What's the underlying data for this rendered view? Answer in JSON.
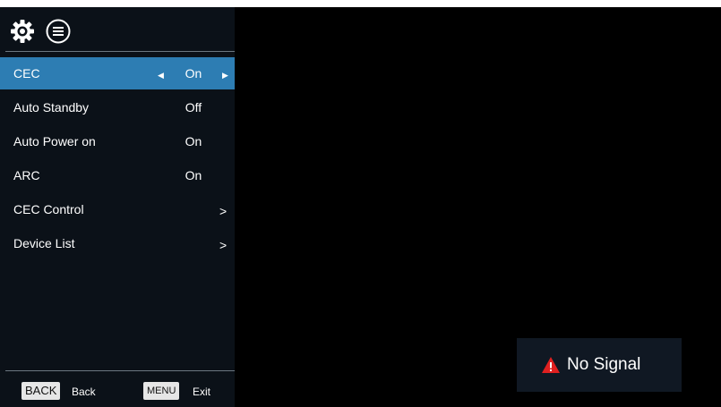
{
  "colors": {
    "screen_background": "#000000",
    "panel_background": "#0b1118",
    "selected_row": "#2d7db3",
    "warning_red": "#e02020"
  },
  "header": {
    "icons": [
      "settings-icon",
      "list-icon"
    ]
  },
  "menu": {
    "items": [
      {
        "label": "CEC",
        "value": "On",
        "selected": true,
        "control": "left-right-arrows"
      },
      {
        "label": "Auto Standby",
        "value": "Off",
        "selected": false,
        "control": "none"
      },
      {
        "label": "Auto Power on",
        "value": "On",
        "selected": false,
        "control": "none"
      },
      {
        "label": "ARC",
        "value": "On",
        "selected": false,
        "control": "none"
      },
      {
        "label": "CEC Control",
        "value": "",
        "selected": false,
        "control": "chevron",
        "chevron": ">"
      },
      {
        "label": "Device List",
        "value": "",
        "selected": false,
        "control": "chevron",
        "chevron": ">"
      }
    ],
    "left_arrow": "◀",
    "right_arrow": "▶"
  },
  "footer": {
    "back_key": "BACK",
    "back_label": "Back",
    "menu_key": "MENU",
    "exit_label": "Exit"
  },
  "status": {
    "icon": "warning-icon",
    "message": "No Signal"
  }
}
